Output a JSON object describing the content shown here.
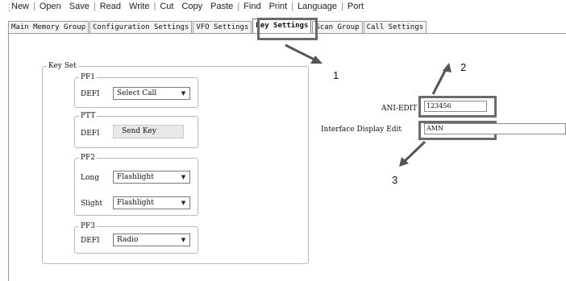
{
  "menu": {
    "items": [
      "New",
      "Open",
      "Save",
      "Read",
      "Write",
      "Cut",
      "Copy",
      "Paste",
      "Find",
      "Print",
      "Language",
      "Port"
    ]
  },
  "tabs": [
    {
      "label": "Main Memory Group"
    },
    {
      "label": "Configuration Settings"
    },
    {
      "label": "VFO Settings"
    },
    {
      "label": "Key Settings",
      "active": true
    },
    {
      "label": "Scan Group"
    },
    {
      "label": "Call Settings"
    }
  ],
  "key_set": {
    "title": "Key Set",
    "pf1": {
      "title": "PF1",
      "defi_label": "DEFI",
      "defi_value": "Select Call"
    },
    "ptt": {
      "title": "PTT",
      "defi_label": "DEFI",
      "defi_value": "Send Key"
    },
    "pf2": {
      "title": "PF2",
      "long_label": "Long",
      "long_value": "Flashlight",
      "slight_label": "Slight",
      "slight_value": "Flashlight"
    },
    "pf3": {
      "title": "PF3",
      "defi_label": "DEFI",
      "defi_value": "Radio"
    }
  },
  "ani_edit": {
    "label": "ANI-EDIT",
    "value": "123456"
  },
  "interface_display": {
    "label": "Interface Display Edit",
    "value": "AMN"
  },
  "callouts": [
    "1",
    "2",
    "3"
  ],
  "colors": {
    "highlight": "#6b6b6b",
    "arrow": "#555555"
  },
  "icons": {
    "combo_arrow": "chevron-down-icon"
  }
}
